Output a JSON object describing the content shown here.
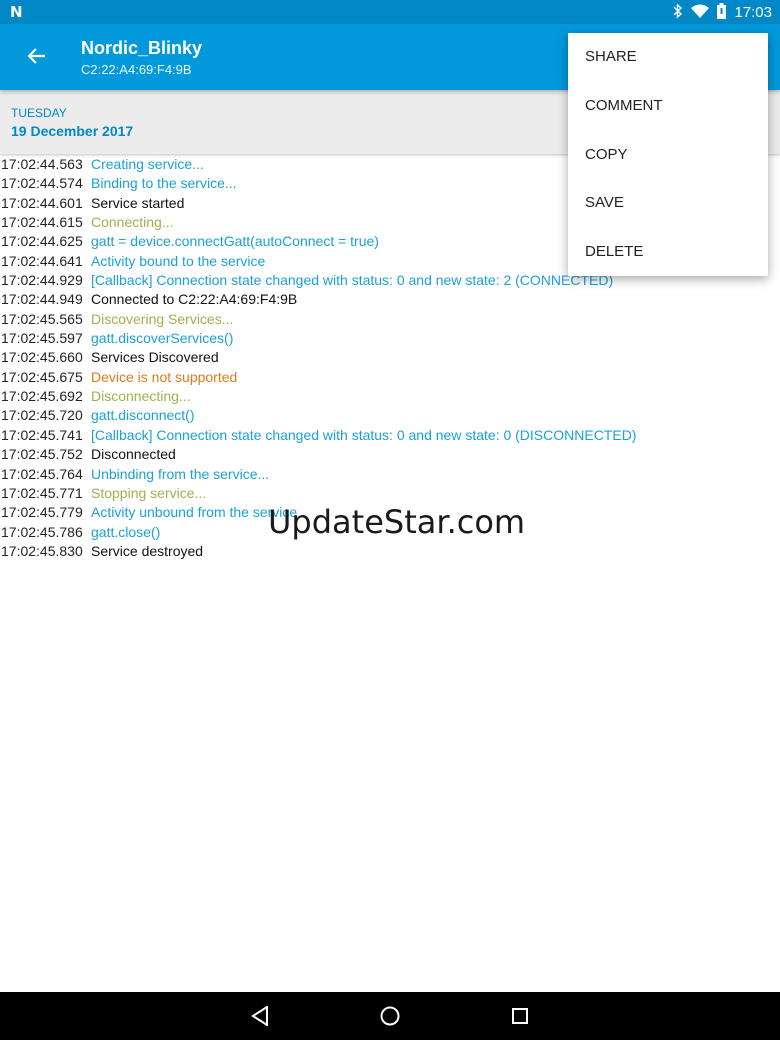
{
  "status_bar": {
    "time": "17:03",
    "icons": [
      "n-logo-icon",
      "bluetooth-icon",
      "wifi-icon",
      "battery-icon"
    ]
  },
  "app_bar": {
    "title": "Nordic_Blinky",
    "subtitle": "C2:22:A4:69:F4:9B"
  },
  "date_header": {
    "day_of_week": "TUESDAY",
    "date": "19 December 2017"
  },
  "log": [
    {
      "time": "17:02:44.563",
      "message": "Creating service...",
      "level": "debug"
    },
    {
      "time": "17:02:44.574",
      "message": "Binding to the service...",
      "level": "debug"
    },
    {
      "time": "17:02:44.601",
      "message": "Service started",
      "level": "info"
    },
    {
      "time": "17:02:44.615",
      "message": "Connecting...",
      "level": "verbose"
    },
    {
      "time": "17:02:44.625",
      "message": "gatt = device.connectGatt(autoConnect = true)",
      "level": "debug"
    },
    {
      "time": "17:02:44.641",
      "message": "Activity bound to the service",
      "level": "debug"
    },
    {
      "time": "17:02:44.929",
      "message": "[Callback] Connection state changed with status: 0 and new state: 2 (CONNECTED)",
      "level": "debug"
    },
    {
      "time": "17:02:44.949",
      "message": "Connected to C2:22:A4:69:F4:9B",
      "level": "info"
    },
    {
      "time": "17:02:45.565",
      "message": "Discovering Services...",
      "level": "verbose"
    },
    {
      "time": "17:02:45.597",
      "message": "gatt.discoverServices()",
      "level": "debug"
    },
    {
      "time": "17:02:45.660",
      "message": "Services Discovered",
      "level": "info"
    },
    {
      "time": "17:02:45.675",
      "message": "Device is not supported",
      "level": "warning"
    },
    {
      "time": "17:02:45.692",
      "message": "Disconnecting...",
      "level": "verbose"
    },
    {
      "time": "17:02:45.720",
      "message": "gatt.disconnect()",
      "level": "debug"
    },
    {
      "time": "17:02:45.741",
      "message": "[Callback] Connection state changed with status: 0 and new state: 0 (DISCONNECTED)",
      "level": "debug"
    },
    {
      "time": "17:02:45.752",
      "message": "Disconnected",
      "level": "info"
    },
    {
      "time": "17:02:45.764",
      "message": "Unbinding from the service...",
      "level": "debug"
    },
    {
      "time": "17:02:45.771",
      "message": "Stopping service...",
      "level": "verbose"
    },
    {
      "time": "17:02:45.779",
      "message": "Activity unbound from the service",
      "level": "debug"
    },
    {
      "time": "17:02:45.786",
      "message": "gatt.close()",
      "level": "debug"
    },
    {
      "time": "17:02:45.830",
      "message": "Service destroyed",
      "level": "info"
    }
  ],
  "watermark": "UpdateStar.com",
  "menu": {
    "items": [
      "SHARE",
      "COMMENT",
      "COPY",
      "SAVE",
      "DELETE"
    ]
  },
  "colors": {
    "primary": "#0299dc",
    "primary_dark": "#0288c7",
    "log_debug": "#1ba1d6",
    "log_verbose": "#a7ad4f",
    "log_info": "#111111",
    "log_warning": "#e07b1a"
  }
}
